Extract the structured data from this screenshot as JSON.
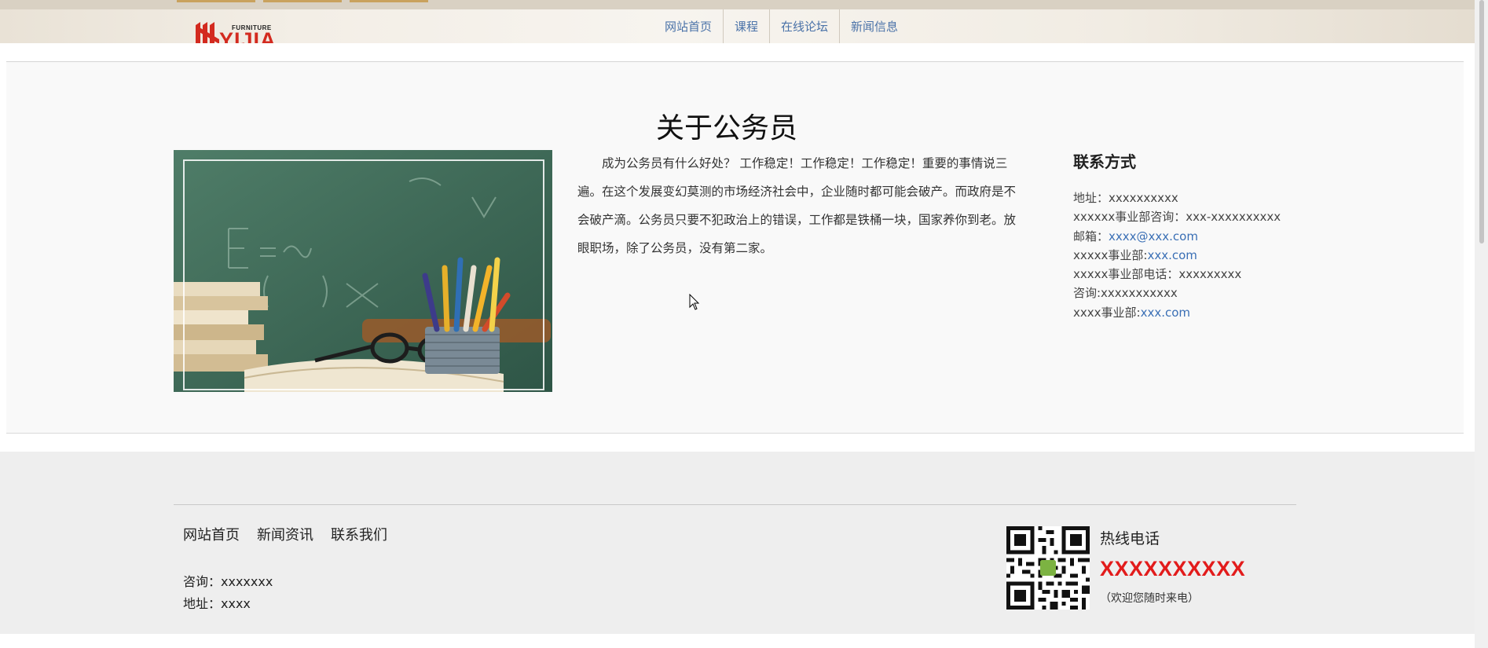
{
  "header": {
    "logo_small": "FURNITURE",
    "logo_brand": "YIJIA",
    "nav": [
      "网站首页",
      "课程",
      "在线论坛",
      "新闻信息"
    ]
  },
  "main": {
    "title": "关于公务员",
    "intro": "成为公务员有什么好处？ 工作稳定！工作稳定！工作稳定！重要的事情说三遍。在这个发展变幻莫测的市场经济社会中，企业随时都可能会破产。而政府是不会破产滴。公务员只要不犯政治上的错误，工作都是铁桶一块，国家养你到老。放眼职场，除了公务员，没有第二家。",
    "contact": {
      "heading": "联系方式",
      "address": "地址：xxxxxxxxxx",
      "consult_line": "xxxxxx事业部咨询：xxx-xxxxxxxxxx",
      "email_label": "邮箱：",
      "email_value": "xxxx@xxx.com",
      "dept_label": "xxxxx事业部:",
      "dept_link": "xxx.com",
      "phone_line": "xxxxx事业部电话：xxxxxxxxx",
      "consult2": "咨询:xxxxxxxxxxx",
      "dept2_label": "xxxx事业部:",
      "dept2_link": "xxx.com"
    }
  },
  "footer": {
    "nav": [
      "网站首页",
      "新闻资讯",
      "联系我们"
    ],
    "consult": "咨询：xxxxxxx",
    "address": "地址：xxxx",
    "hotline_label": "热线电话",
    "hotline_number": "XXXXXXXXXX",
    "hotline_note": "（欢迎您随时来电）"
  },
  "colors": {
    "accent_link": "#4a72a8",
    "hotline": "#e21b1b",
    "logo": "#d32a1f"
  }
}
